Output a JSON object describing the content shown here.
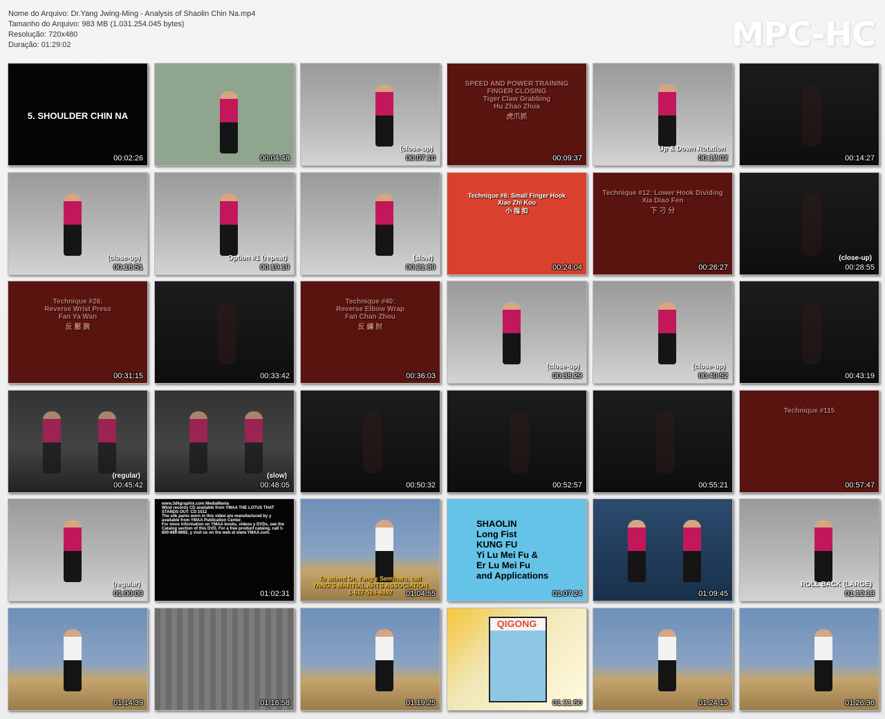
{
  "header": {
    "lines": [
      "Nome do Arquivo: Dr.Yang Jwing-Ming - Analysis of Shaolin Chin Na.mp4",
      "Tamanho do Arquivo: 983 MB (1.031.254.045 bytes)",
      "Resolução: 720x480",
      "Duração: 01:29:02"
    ],
    "brand": "MPC-HC"
  },
  "thumbnails": [
    {
      "ts": "00:02:26",
      "theme": "black",
      "caption": "5. SHOULDER CHIN NA"
    },
    {
      "ts": "00:04:48",
      "theme": "green",
      "caption": ""
    },
    {
      "ts": "00:07:10",
      "theme": "gray",
      "caption": "(close-up)"
    },
    {
      "ts": "00:09:37",
      "theme": "red",
      "caption": "SPEED AND POWER TRAINING FINGER CLOSING\nTiger Claw Grabbing\nHu Zhao Zhua\n虎爪抓"
    },
    {
      "ts": "00:12:02",
      "theme": "gray",
      "caption": "Up & Down Rotation"
    },
    {
      "ts": "00:14:27",
      "theme": "dark",
      "caption": ""
    },
    {
      "ts": "00:16:51",
      "theme": "gray",
      "caption": "(close-up)"
    },
    {
      "ts": "00:19:19",
      "theme": "gray",
      "caption": "Option #1 (repeat)"
    },
    {
      "ts": "00:21:39",
      "theme": "gray",
      "caption": "(slow)"
    },
    {
      "ts": "00:24:04",
      "theme": "orange",
      "caption": "Technique #6: Small Finger Hook\nXiao Zhi Kou\n小 指 扣"
    },
    {
      "ts": "00:26:27",
      "theme": "red",
      "caption": "Technique #12: Lower Hook Dividing\nXia Diao Fen\n下 刁 分"
    },
    {
      "ts": "00:28:55",
      "theme": "dark",
      "caption": "(close-up)"
    },
    {
      "ts": "00:31:15",
      "theme": "red",
      "caption": "Technique #26:\nReverse Wrist Press\nFan Ya Wan\n反 壓 腕"
    },
    {
      "ts": "00:33:42",
      "theme": "dark",
      "caption": ""
    },
    {
      "ts": "00:36:03",
      "theme": "red",
      "caption": "Technique #40:\nReverse Elbow Wrap\nFan Chan Zhou\n反 纏 肘"
    },
    {
      "ts": "00:38:29",
      "theme": "gray",
      "caption": "(close-up)"
    },
    {
      "ts": "00:40:52",
      "theme": "gray",
      "caption": "(close-up)"
    },
    {
      "ts": "00:43:19",
      "theme": "dark",
      "caption": ""
    },
    {
      "ts": "00:45:42",
      "theme": "stage",
      "caption": "(regular)"
    },
    {
      "ts": "00:48:05",
      "theme": "stage",
      "caption": "(slow)"
    },
    {
      "ts": "00:50:32",
      "theme": "dark",
      "caption": ""
    },
    {
      "ts": "00:52:57",
      "theme": "dark",
      "caption": ""
    },
    {
      "ts": "00:55:21",
      "theme": "dark",
      "caption": ""
    },
    {
      "ts": "00:57:47",
      "theme": "red",
      "caption": "Technique #115"
    },
    {
      "ts": "01:00:09",
      "theme": "gray",
      "caption": "(regular)"
    },
    {
      "ts": "01:02:31",
      "theme": "black",
      "caption": "www.3dkgraphix.com MediaMania\nWind records CD available from YMAA THE LOTUS THAT STANDS OUT: CD 1012\nThe silk pants worn in this video are manufactured by y available from YMAA Publication Center.\nFor more information on YMAA books, videos y DVDs, see the Catalog section of this DVD. For a free product catalog, call 1-800-669-8892, y visit us on the web at www.YMAA.com."
    },
    {
      "ts": "01:04:55",
      "theme": "blue",
      "caption": "To attend Dr. Yang's Seminars, call YANG'S MARTIAL ARTS ASSOCIATION\n1-617-524-8892"
    },
    {
      "ts": "01:07:24",
      "theme": "sky",
      "caption": "SHAOLIN\nLong Fist\nKUNG FU\nYi Lu Mei Fu &\nEr Lu Mei Fu\nand Applications"
    },
    {
      "ts": "01:09:45",
      "theme": "navy",
      "caption": ""
    },
    {
      "ts": "01:12:13",
      "theme": "gray",
      "caption": "ROLL BACK (LARGE)"
    },
    {
      "ts": "01:14:39",
      "theme": "blue",
      "caption": ""
    },
    {
      "ts": "01:16:58",
      "theme": "curtain",
      "caption": ""
    },
    {
      "ts": "01:19:25",
      "theme": "blue",
      "caption": ""
    },
    {
      "ts": "01:21:50",
      "theme": "cream",
      "caption": "QIGONG"
    },
    {
      "ts": "01:24:15",
      "theme": "blue",
      "caption": ""
    },
    {
      "ts": "01:26:36",
      "theme": "blue",
      "caption": ""
    }
  ]
}
